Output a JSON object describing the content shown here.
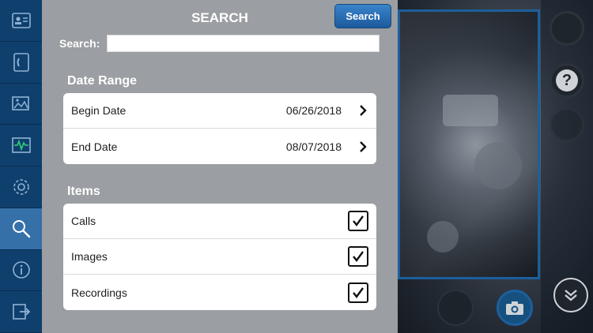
{
  "nav": [
    {
      "icon": "contact-card-icon",
      "active": false
    },
    {
      "icon": "phone-book-icon",
      "active": false
    },
    {
      "icon": "gallery-icon",
      "active": false
    },
    {
      "icon": "waveform-icon",
      "active": false
    },
    {
      "icon": "settings-gear-icon",
      "active": false
    },
    {
      "icon": "search-icon",
      "active": true
    },
    {
      "icon": "info-icon",
      "active": false
    },
    {
      "icon": "exit-icon",
      "active": false
    }
  ],
  "panel": {
    "title": "SEARCH",
    "search_button": "Search",
    "search_label": "Search:",
    "search_value": ""
  },
  "date_range": {
    "title": "Date Range",
    "rows": [
      {
        "label": "Begin Date",
        "value": "06/26/2018"
      },
      {
        "label": "End Date",
        "value": "08/07/2018"
      }
    ]
  },
  "items": {
    "title": "Items",
    "rows": [
      {
        "label": "Calls",
        "checked": true
      },
      {
        "label": "Images",
        "checked": true
      },
      {
        "label": "Recordings",
        "checked": true
      }
    ]
  },
  "controls": {
    "help": "?",
    "accent": "#1c5f9d"
  }
}
